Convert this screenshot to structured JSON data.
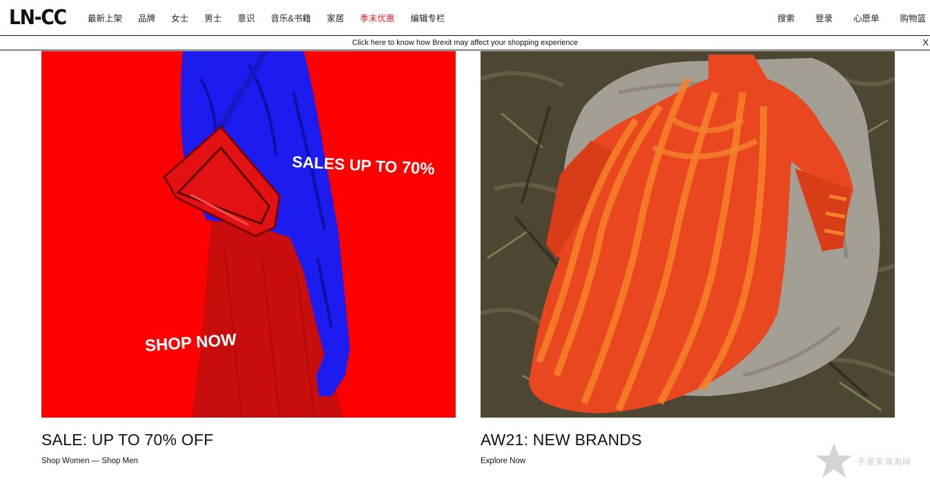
{
  "header": {
    "logo": "LN-CC",
    "nav": [
      "最新上架",
      "品牌",
      "女士",
      "男士",
      "意识",
      "音乐&书籍",
      "家居",
      "季末优惠",
      "编辑专栏"
    ],
    "utility": [
      "搜索",
      "登录",
      "心愿单",
      "购物篮"
    ]
  },
  "notice": {
    "text": "Click here to know how Brexit may affect your shopping experience",
    "close": "X"
  },
  "cards": [
    {
      "overlay_sales": "SALES UP TO",
      "overlay_pct": "70%",
      "overlay_shop": "SHOP NOW",
      "title": "SALE: UP TO 70% OFF",
      "link_women": "Shop Women",
      "separator": " — ",
      "link_men": "Shop Men"
    },
    {
      "title": "AW21: NEW BRANDS",
      "link": "Explore Now"
    }
  ],
  "watermark": "手里来海淘网",
  "colors": {
    "sale_nav": "#d8232a",
    "hero_red": "#ff0000",
    "hero_blue": "#1c1cf0",
    "dress_orange": "#e8471f"
  },
  "icons": [
    "close-icon",
    "star-icon"
  ]
}
